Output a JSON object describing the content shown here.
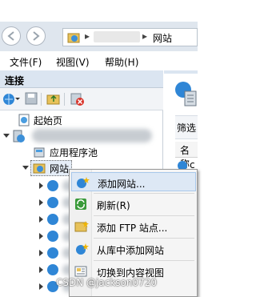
{
  "window": {
    "address_segments": [
      "网站"
    ]
  },
  "menubar": {
    "items": [
      "文件(F)",
      "视图(V)",
      "帮助(H)"
    ]
  },
  "connections": {
    "header": "连接"
  },
  "tree": {
    "start_page": "起始页",
    "app_pools": "应用程序池",
    "sites": "网站"
  },
  "right_pane": {
    "filter_label": "筛选",
    "column_name": "名称",
    "row_partial": "c"
  },
  "context_menu": {
    "items": [
      {
        "label": "添加网站...",
        "highlighted": true
      },
      {
        "label": "刷新(R)"
      },
      {
        "label": "添加 FTP 站点..."
      },
      {
        "label": "从库中添加网站"
      },
      {
        "label": "切换到内容视图"
      }
    ]
  },
  "watermark": "CSDN @jackson0720",
  "colors": {
    "accent": "#dbe5f1",
    "highlight": "#dde8f5"
  }
}
